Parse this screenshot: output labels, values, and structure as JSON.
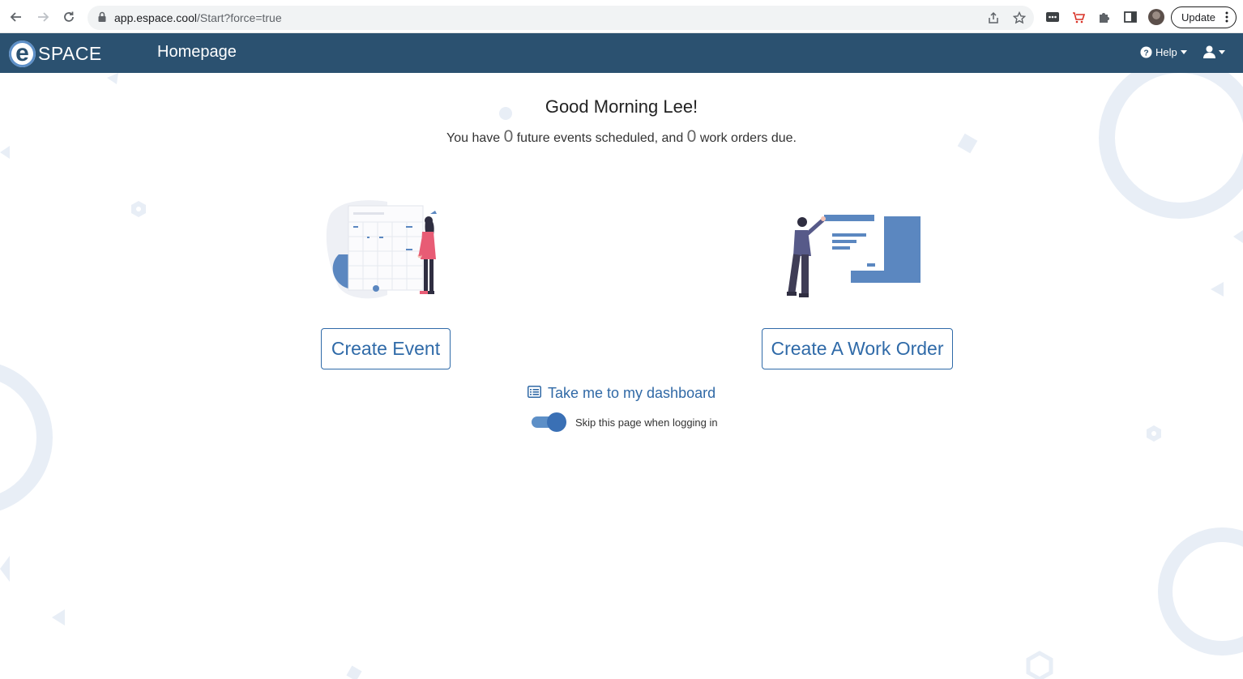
{
  "browser": {
    "url_host": "app.espace.cool",
    "url_path": "/Start?force=true",
    "update_label": "Update"
  },
  "header": {
    "logo_letter": "e",
    "logo_word": "SPACE",
    "title": "Homepage",
    "help_label": "Help"
  },
  "main": {
    "greeting": "Good Morning Lee!",
    "summary_prefix": "You have",
    "events_count": "0",
    "summary_middle": "future events scheduled, and",
    "work_orders_count": "0",
    "summary_suffix": "work orders due.",
    "create_event_label": "Create Event",
    "create_work_order_label": "Create A Work Order",
    "dashboard_link_label": "Take me to my dashboard",
    "skip_toggle_label": "Skip this page when logging in",
    "skip_toggle_on": true
  },
  "colors": {
    "header_bg": "#2b5170",
    "accent": "#2f6aa8",
    "illustration_blue": "#5b87c0",
    "decoration": "#e8eef6"
  },
  "icons": {
    "back": "arrow-left-icon",
    "forward": "arrow-right-icon",
    "reload": "reload-icon",
    "lock": "lock-icon",
    "share": "share-icon",
    "bookmark": "star-icon",
    "extensions": "puzzle-icon",
    "sidepanel": "sidepanel-icon",
    "help": "question-circle-icon",
    "user": "user-icon",
    "dashboard": "list-icon"
  }
}
